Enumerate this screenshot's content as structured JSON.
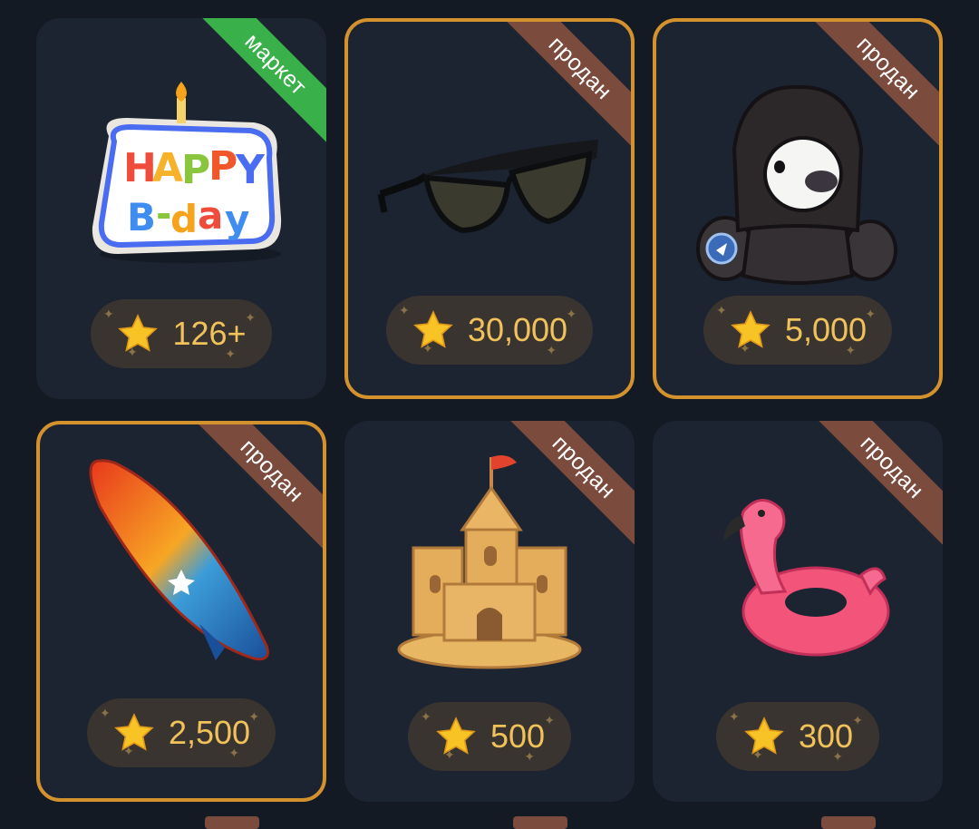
{
  "gifts": [
    {
      "name": "happy-bday",
      "badge": "маркет",
      "price": "126+"
    },
    {
      "name": "sunglasses",
      "badge": "продан",
      "price": "30,000"
    },
    {
      "name": "hooded-teddy",
      "badge": "продан",
      "price": "5,000"
    },
    {
      "name": "surfboard",
      "badge": "продан",
      "price": "2,500"
    },
    {
      "name": "sand-castle",
      "badge": "продан",
      "price": "500"
    },
    {
      "name": "flamingo-float",
      "badge": "продан",
      "price": "300"
    }
  ],
  "colors": {
    "market_badge": "#3ab04a",
    "sold_badge": "#7b4b3e",
    "highlight_border": "#d4922e",
    "price_text": "#f1c25a"
  }
}
